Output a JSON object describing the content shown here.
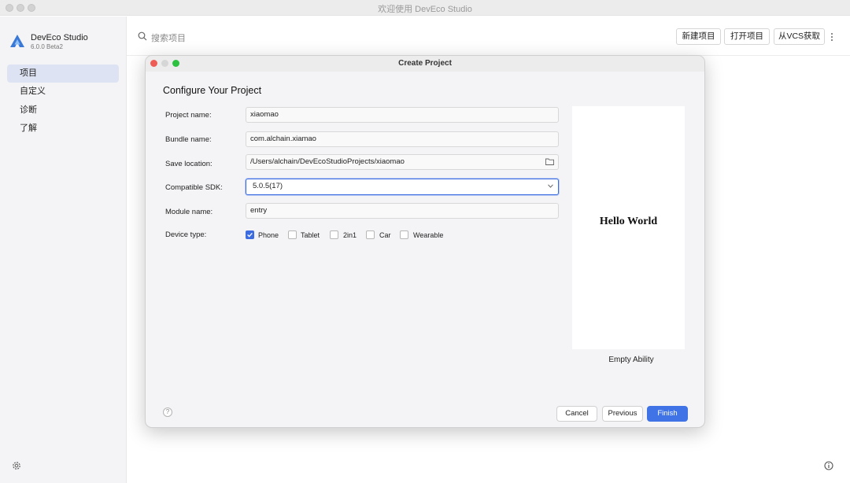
{
  "window": {
    "title": "欢迎使用 DevEco Studio"
  },
  "sidebar": {
    "app_name": "DevEco Studio",
    "app_version": "6.0.0 Beta2",
    "items": [
      {
        "label": "项目",
        "active": true
      },
      {
        "label": "自定义",
        "active": false
      },
      {
        "label": "诊断",
        "active": false
      },
      {
        "label": "了解",
        "active": false
      }
    ],
    "settings_icon": "gear-icon"
  },
  "topbar": {
    "search_placeholder": "搜索项目",
    "buttons": {
      "new_project": "新建项目",
      "open_project": "打开项目",
      "get_from_vcs": "从VCS获取"
    },
    "more_icon": "vertical-ellipsis-icon"
  },
  "dialog": {
    "title": "Create Project",
    "heading": "Configure Your Project",
    "fields": {
      "project_name": {
        "label": "Project name:",
        "value": "xiaomao"
      },
      "bundle_name": {
        "label": "Bundle name:",
        "value": "com.alchain.xiamao"
      },
      "save_location": {
        "label": "Save location:",
        "value": "/Users/alchain/DevEcoStudioProjects/xiaomao"
      },
      "compatible_sdk": {
        "label": "Compatible SDK:",
        "value": "5.0.5(17)"
      },
      "module_name": {
        "label": "Module name:",
        "value": "entry"
      }
    },
    "device_type": {
      "label": "Device type:",
      "options": [
        {
          "label": "Phone",
          "checked": true
        },
        {
          "label": "Tablet",
          "checked": false
        },
        {
          "label": "2in1",
          "checked": false
        },
        {
          "label": "Car",
          "checked": false
        },
        {
          "label": "Wearable",
          "checked": false
        }
      ]
    },
    "preview": {
      "text": "Hello World",
      "caption": "Empty Ability"
    },
    "help": "?",
    "buttons": {
      "cancel": "Cancel",
      "previous": "Previous",
      "finish": "Finish"
    }
  },
  "colors": {
    "accent": "#3f73e6",
    "sidebar_active": "#dde3f3",
    "close": "#ee5d55",
    "minimize": "#d6d6d6",
    "zoom": "#2cc13f"
  }
}
